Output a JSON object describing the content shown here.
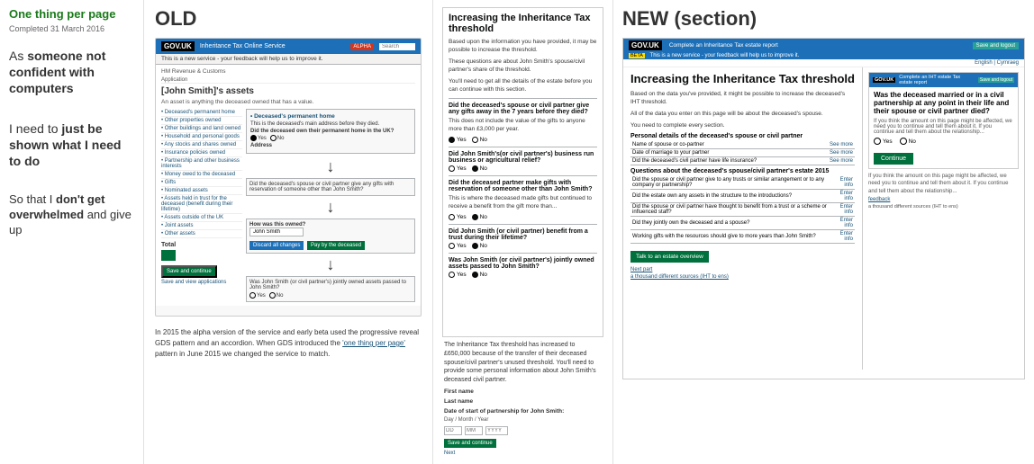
{
  "sidebar": {
    "title": "One thing per page",
    "completed": "Completed 31 March 2016",
    "section1": "As someone not confident with computers",
    "section2_prefix": "I need to ",
    "section2_bold": "just be shown what I need to do",
    "section3_prefix": "So that I ",
    "section3_bold": "don't get overwhelmed",
    "section3_suffix": " and  give up"
  },
  "old_section": {
    "label": "OLD",
    "browser": {
      "logo": "GOV.UK",
      "title": "Inheritance Tax Online Service",
      "badge": "ALPHA",
      "subtext": "This is a new service - your feedback will help us to improve it.",
      "org": "HM Revenue & Customs"
    },
    "breadcrumb": "Application",
    "page_title": "[John Smith]'s assets",
    "page_description": "An asset is anything the deceased owned that has a value.",
    "nav_items": [
      "Deceased's permanent home",
      "Other properties owned",
      "Other buildings and land owned",
      "Did the deceased own their permanent home in the UK?",
      "Household and personal goods",
      "Any stocks and shares owned",
      "Insurance policies owned",
      "Partnership and other business interests",
      "Money owed to the deceased",
      "Gifts",
      "Nominated assets",
      "Assets held in trust for the deceased (benefit during their lifetime)",
      "Assets outside of the UK",
      "Joint assets",
      "Other assets",
      "Total"
    ],
    "nav_active": "Deceased's permanent home",
    "form_label": "How was this owned?",
    "form_input": "John Smith",
    "button_cancel": "Discard all changes",
    "button_pay": "Pay by the deceased",
    "save_button": "Save and continue",
    "view_link": "Save and view applications"
  },
  "middle_section": {
    "title": "Increasing the Inheritance Tax threshold",
    "para1": "Based upon the information you have provided, it may be possible to increase the threshold.",
    "para2": "These questions are about John Smith's spouse/civil partner's share of the threshold.",
    "para3": "You'll need to get all the details of the estate before you can continue with this section.",
    "q1": "Did the deceased's spouse or civil partner give any gifts away in the 7 years before they died?",
    "q1_hint": "This does not include the value of the gifts to anyone more than £3,000 per year.",
    "q2": "Did John Smith's(or civil partner's) business run business or agricultural relief?",
    "q3": "Did the deceased partner make gifts with reservation of someone other than John Smith?",
    "q3_hint": "This is where the deceased made gifts but continued to receive a benefit from the gift more than...",
    "q4": "Did John Smith (or civil partner) benefit from a trust during their lifetime?",
    "q5": "Was John Smith (or civil partner's) jointly owned assets passed to John Smith?",
    "footer_text": "The Inheritance Tax threshold has increased to £650,000 because of the transfer of their deceased spouse/civil partner's unused threshold. You'll need to provide some personal information about John Smith's deceased civil partner.",
    "field_firstname": "First name",
    "field_lastname": "Last name",
    "field_dob": "Date of start of partnership for John Smith:",
    "continue_button": "Save and continue",
    "next_link": "Next"
  },
  "new_section": {
    "label": "NEW (section)",
    "browser": {
      "logo": "GOV.UK",
      "title": "Complete an Inheritance Tax estate report",
      "button": "Save and logout"
    },
    "page_title": "Increasing the Inheritance Tax threshold",
    "page_para": "Based on the data you've provided, it might be possible to increase the deceased's IHT threshold.",
    "page_para2": "All of the data you enter on this page will be about the deceased's spouse.",
    "action_text": "You need to complete every section.",
    "table_sections": [
      {
        "label": "Name of spouse or co-partner",
        "link": "See more"
      },
      {
        "label": "Date of marriage to your partner",
        "link": "See more"
      },
      {
        "label": "Did the deceased's civil partner have life insurance?",
        "link": "See more"
      }
    ],
    "table_header_q": "Questions about the deceased's spouse/civil partner's estate 2015",
    "table_rows": [
      {
        "question": "Did the spouse or civil partner give to any trusts or similar arrangement or to any company or partnership?",
        "link": "Enter info"
      },
      {
        "question": "Did the estate own any assets in the structure to the introductions?",
        "link": "Enter info"
      },
      {
        "question": "Did the spouse or civil partner have thought to benefit from a trust or a scheme or influenced staff?",
        "link": "Enter info"
      },
      {
        "question": "Did they jointly own the deceased and a spouse?",
        "link": "Enter info"
      },
      {
        "question": "Working gifts with the resources should give to more years than John Smith?",
        "link": "Enter info"
      }
    ],
    "continue_button": "Talk to an estate overview",
    "next_link": "Next part",
    "link2": "a thousand different sources (IHT to ens)",
    "question_box": {
      "title": "Was the deceased married or in a civil partnership at any point in their life and their spouse or civil partner died?",
      "hint": "If you think the amount on this page might be affected, we need you to continue and tell them about it. If you continue and tell them about the relationship...",
      "options": [
        "Yes",
        "No"
      ],
      "button": "Continue"
    }
  }
}
